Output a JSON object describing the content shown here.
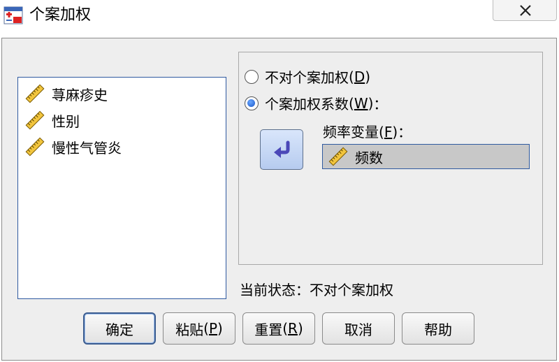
{
  "window": {
    "title": "个案加权",
    "app_icon": "spss-dialog-icon",
    "close_icon": "close-icon"
  },
  "variables": [
    {
      "label": "荨麻疹史",
      "icon": "ruler-icon"
    },
    {
      "label": "性别",
      "icon": "ruler-icon"
    },
    {
      "label": "慢性气管炎",
      "icon": "ruler-icon"
    }
  ],
  "weight_options": {
    "no_weight": {
      "label": "不对个案加权",
      "mnemonic": "(D)",
      "mnemonic_key": "D",
      "selected": false
    },
    "weight_by": {
      "label": "个案加权系数",
      "mnemonic": "(W)",
      "mnemonic_key": "W",
      "suffix": "：",
      "selected": true
    }
  },
  "frequency": {
    "label": "频率变量",
    "mnemonic_key": "F",
    "suffix": "：",
    "value": "频数",
    "icon": "ruler-icon"
  },
  "move_button_icon": "arrow-left-icon",
  "status": {
    "label": "当前状态：",
    "value": "不对个案加权"
  },
  "buttons": {
    "ok": "确定",
    "paste": "粘贴",
    "paste_key": "P",
    "reset": "重置",
    "reset_key": "R",
    "cancel": "取消",
    "help": "帮助"
  },
  "colors": {
    "accent": "#2f5aa0",
    "dialog_bg": "#eeeeee",
    "field_bg": "#c8c8c8",
    "radio_selected": "#1a56c8"
  }
}
